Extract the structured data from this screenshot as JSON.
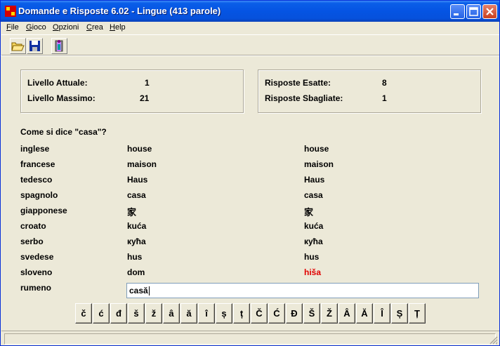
{
  "window": {
    "title": "Domande e Risposte 6.02 - Lingue (413 parole)"
  },
  "menu": [
    {
      "key": "F",
      "rest": "ile"
    },
    {
      "key": "G",
      "rest": "ioco"
    },
    {
      "key": "O",
      "rest": "pzioni"
    },
    {
      "key": "C",
      "rest": "rea"
    },
    {
      "key": "H",
      "rest": "elp"
    }
  ],
  "stats": {
    "livello_attuale_label": "Livello Attuale:",
    "livello_attuale": "1",
    "livello_massimo_label": "Livello Massimo:",
    "livello_massimo": "21",
    "risposte_esatte_label": "Risposte Esatte:",
    "risposte_esatte": "8",
    "risposte_sbagliate_label": "Risposte Sbagliate:",
    "risposte_sbagliate": "1"
  },
  "question": "Come si dice \"casa\"?",
  "rows": [
    {
      "language": "inglese",
      "given": "house",
      "correct": "house"
    },
    {
      "language": "francese",
      "given": "maison",
      "correct": "maison"
    },
    {
      "language": "tedesco",
      "given": "Haus",
      "correct": "Haus"
    },
    {
      "language": "spagnolo",
      "given": "casa",
      "correct": "casa"
    },
    {
      "language": "giapponese",
      "given": "家",
      "correct": "家"
    },
    {
      "language": "croato",
      "given": "kuća",
      "correct": "kuća"
    },
    {
      "language": "serbo",
      "given": "кућа",
      "correct": "кућа"
    },
    {
      "language": "svedese",
      "given": "hus",
      "correct": "hus"
    },
    {
      "language": "sloveno",
      "given": "dom",
      "correct": "hiša"
    }
  ],
  "current": {
    "language": "rumeno",
    "input_value": "casă"
  },
  "special_chars": [
    "č",
    "ć",
    "đ",
    "š",
    "ž",
    "â",
    "ă",
    "î",
    "ș",
    "ț",
    "Č",
    "Ć",
    "Đ",
    "Š",
    "Ž",
    "Â",
    "Ă",
    "Î",
    "Ș",
    "Ț"
  ],
  "colors": {
    "wrong": "#e00000",
    "titlebar": "#0554e3"
  }
}
